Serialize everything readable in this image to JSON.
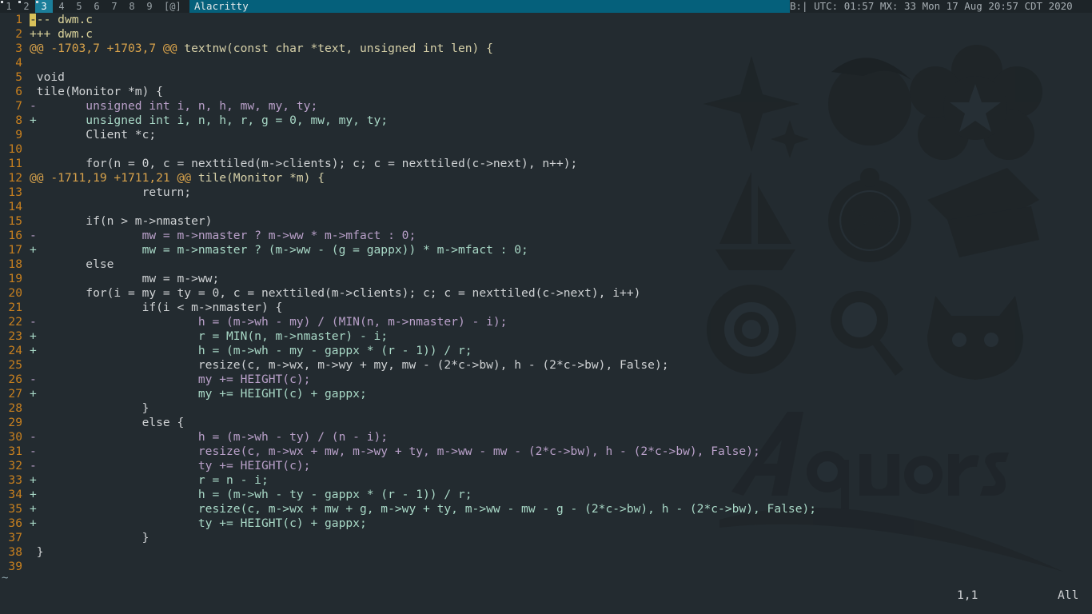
{
  "topbar": {
    "workspaces": [
      {
        "label": "1",
        "active": false,
        "occupied": true
      },
      {
        "label": "2",
        "active": false,
        "occupied": true
      },
      {
        "label": "3",
        "active": true,
        "occupied": true
      },
      {
        "label": "4",
        "active": false,
        "occupied": false
      },
      {
        "label": "5",
        "active": false,
        "occupied": false
      },
      {
        "label": "6",
        "active": false,
        "occupied": false
      },
      {
        "label": "7",
        "active": false,
        "occupied": false
      },
      {
        "label": "8",
        "active": false,
        "occupied": false
      },
      {
        "label": "9",
        "active": false,
        "occupied": false
      }
    ],
    "layout_symbol": "[@]",
    "window_title": "Alacritty",
    "status_text": "B:| UTC: 01:57 MX: 33 Mon 17 Aug 20:57 CDT 2020",
    "active_color": "#1b7e9a",
    "title_color": "#05607b"
  },
  "wallpaper": {
    "emblems": [
      "sparkle-emblem",
      "dolphin-emblem",
      "star-flower-emblem",
      "sailboat-emblem",
      "orange-slice-emblem",
      "piano-emblem",
      "spiral-flower-emblem",
      "magnifier-candy-emblem",
      "devil-face-emblem"
    ],
    "logo_text": "Aqours"
  },
  "editor": {
    "lines": [
      {
        "num": "1",
        "text": "--- dwm.c",
        "kind": "meta"
      },
      {
        "num": "2",
        "text": "+++ dwm.c",
        "kind": "meta"
      },
      {
        "num": "3",
        "text": "@@ -1703,7 +1703,7 @@",
        "suffix": " textnw(const char *text, unsigned int len) {",
        "kind": "hunk"
      },
      {
        "num": "4",
        "text": "",
        "kind": "ctx"
      },
      {
        "num": "5",
        "text": " void",
        "kind": "ctx"
      },
      {
        "num": "6",
        "text": " tile(Monitor *m) {",
        "kind": "ctx"
      },
      {
        "num": "7",
        "text": "-       unsigned int i, n, h, mw, my, ty;",
        "kind": "del"
      },
      {
        "num": "8",
        "text": "+       unsigned int i, n, h, r, g = 0, mw, my, ty;",
        "kind": "add"
      },
      {
        "num": "9",
        "text": "        Client *c;",
        "kind": "ctx"
      },
      {
        "num": "10",
        "text": "",
        "kind": "ctx"
      },
      {
        "num": "11",
        "text": "        for(n = 0, c = nexttiled(m->clients); c; c = nexttiled(c->next), n++);",
        "kind": "ctx"
      },
      {
        "num": "12",
        "text": "@@ -1711,19 +1711,21 @@",
        "suffix": " tile(Monitor *m) {",
        "kind": "hunk"
      },
      {
        "num": "13",
        "text": "                return;",
        "kind": "ctx"
      },
      {
        "num": "14",
        "text": "",
        "kind": "ctx"
      },
      {
        "num": "15",
        "text": "        if(n > m->nmaster)",
        "kind": "ctx"
      },
      {
        "num": "16",
        "text": "-               mw = m->nmaster ? m->ww * m->mfact : 0;",
        "kind": "del"
      },
      {
        "num": "17",
        "text": "+               mw = m->nmaster ? (m->ww - (g = gappx)) * m->mfact : 0;",
        "kind": "add"
      },
      {
        "num": "18",
        "text": "        else",
        "kind": "ctx"
      },
      {
        "num": "19",
        "text": "                mw = m->ww;",
        "kind": "ctx"
      },
      {
        "num": "20",
        "text": "        for(i = my = ty = 0, c = nexttiled(m->clients); c; c = nexttiled(c->next), i++)",
        "kind": "ctx"
      },
      {
        "num": "21",
        "text": "                if(i < m->nmaster) {",
        "kind": "ctx"
      },
      {
        "num": "22",
        "text": "-                       h = (m->wh - my) / (MIN(n, m->nmaster) - i);",
        "kind": "del"
      },
      {
        "num": "23",
        "text": "+                       r = MIN(n, m->nmaster) - i;",
        "kind": "add"
      },
      {
        "num": "24",
        "text": "+                       h = (m->wh - my - gappx * (r - 1)) / r;",
        "kind": "add"
      },
      {
        "num": "25",
        "text": "                        resize(c, m->wx, m->wy + my, mw - (2*c->bw), h - (2*c->bw), False);",
        "kind": "ctx"
      },
      {
        "num": "26",
        "text": "-                       my += HEIGHT(c);",
        "kind": "del"
      },
      {
        "num": "27",
        "text": "+                       my += HEIGHT(c) + gappx;",
        "kind": "add"
      },
      {
        "num": "28",
        "text": "                }",
        "kind": "ctx"
      },
      {
        "num": "29",
        "text": "                else {",
        "kind": "ctx"
      },
      {
        "num": "30",
        "text": "-                       h = (m->wh - ty) / (n - i);",
        "kind": "del"
      },
      {
        "num": "31",
        "text": "-                       resize(c, m->wx + mw, m->wy + ty, m->ww - mw - (2*c->bw), h - (2*c->bw), False);",
        "kind": "del"
      },
      {
        "num": "32",
        "text": "-                       ty += HEIGHT(c);",
        "kind": "del"
      },
      {
        "num": "33",
        "text": "+                       r = n - i;",
        "kind": "add"
      },
      {
        "num": "34",
        "text": "+                       h = (m->wh - ty - gappx * (r - 1)) / r;",
        "kind": "add"
      },
      {
        "num": "35",
        "text": "+                       resize(c, m->wx + mw + g, m->wy + ty, m->ww - mw - g - (2*c->bw), h - (2*c->bw), False);",
        "kind": "add"
      },
      {
        "num": "36",
        "text": "+                       ty += HEIGHT(c) + gappx;",
        "kind": "add"
      },
      {
        "num": "37",
        "text": "                }",
        "kind": "ctx"
      },
      {
        "num": "38",
        "text": " }",
        "kind": "ctx"
      },
      {
        "num": "39",
        "text": "",
        "kind": "ctx"
      }
    ],
    "empty_marker": "~",
    "cursor_position": "1,1",
    "scroll_position": "All"
  }
}
